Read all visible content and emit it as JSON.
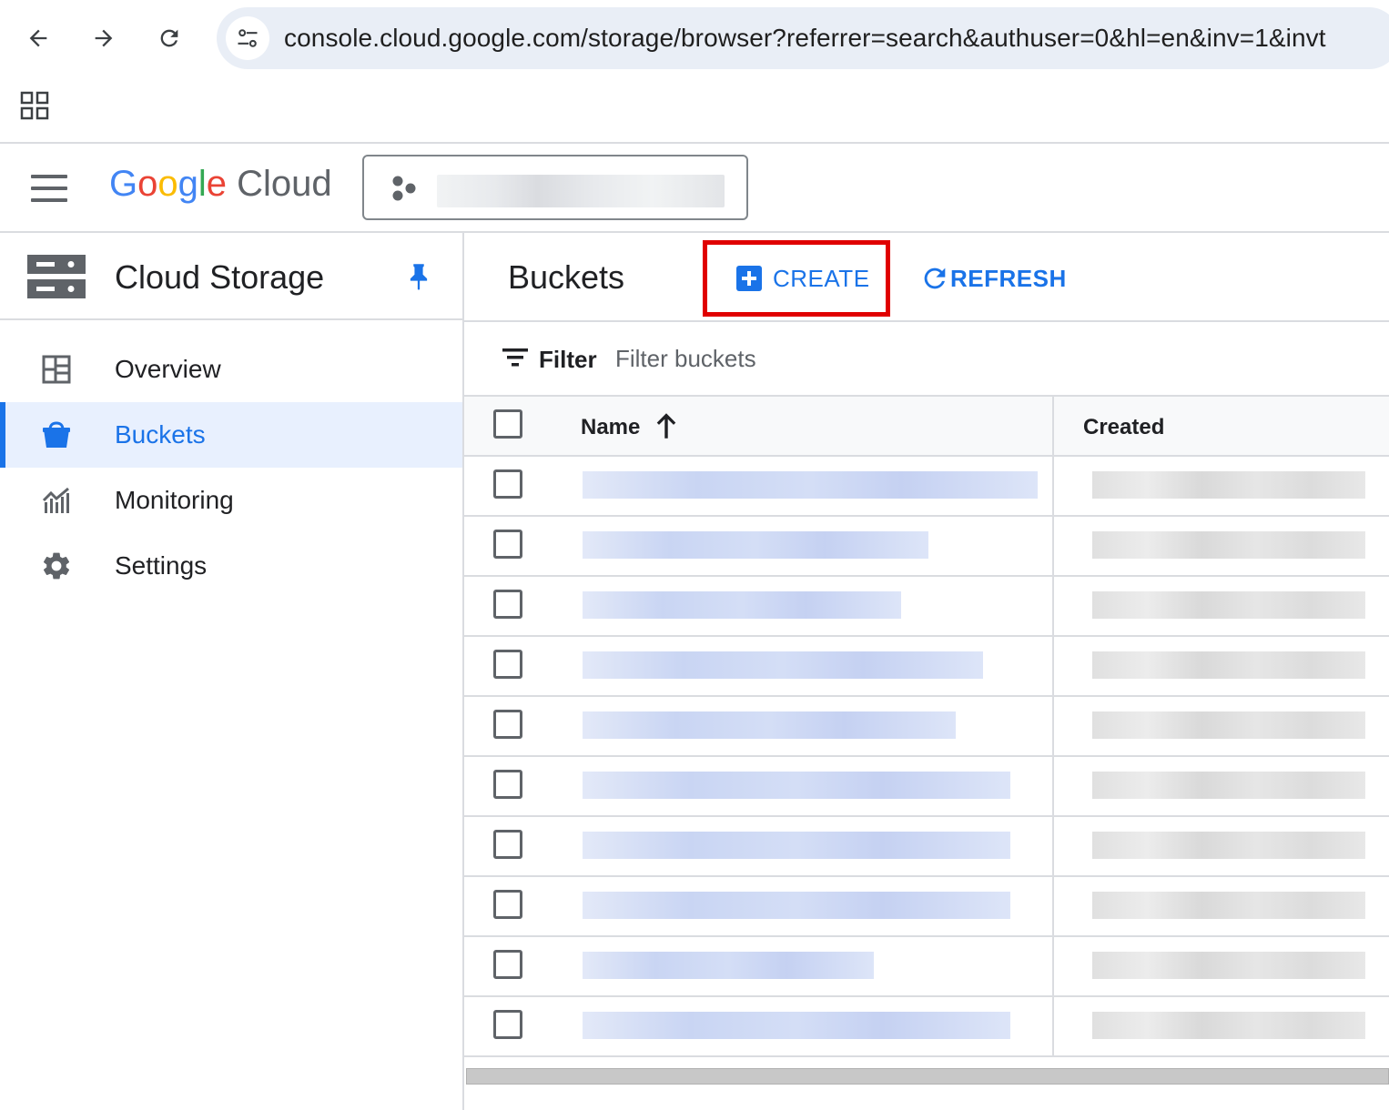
{
  "browser": {
    "url": "console.cloud.google.com/storage/browser?referrer=search&authuser=0&hl=en&inv=1&invt"
  },
  "header": {
    "logo_google": [
      "G",
      "o",
      "o",
      "g",
      "l",
      "e"
    ],
    "logo_cloud": "Cloud"
  },
  "sidebar": {
    "product_title": "Cloud Storage",
    "items": [
      {
        "label": "Overview",
        "icon": "dashboard-icon"
      },
      {
        "label": "Buckets",
        "icon": "bucket-icon",
        "active": true
      },
      {
        "label": "Monitoring",
        "icon": "monitoring-icon"
      },
      {
        "label": "Settings",
        "icon": "gear-icon"
      }
    ]
  },
  "main": {
    "title": "Buckets",
    "create_label": "CREATE",
    "refresh_label": "REFRESH",
    "filter_label": "Filter",
    "filter_placeholder": "Filter buckets",
    "table": {
      "columns": [
        "Name",
        "Created"
      ],
      "sort": "ascending"
    }
  },
  "colors": {
    "accent": "#1a73e8",
    "highlight_box": "#e00000",
    "active_nav_bg": "#e8f0fe"
  }
}
